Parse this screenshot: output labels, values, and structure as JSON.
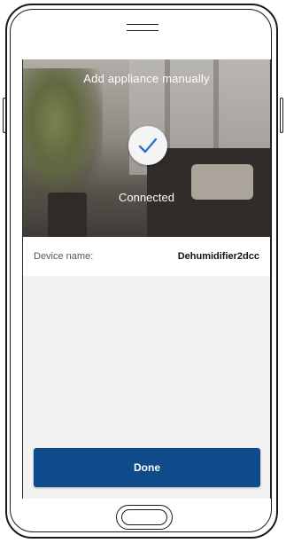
{
  "screen": {
    "title": "Add appliance manually",
    "status": "Connected",
    "status_icon": "checkmark-icon",
    "accent_color": "#0f4a8a"
  },
  "device": {
    "label": "Device name:",
    "value": "Dehumidifier2dcc"
  },
  "actions": {
    "done_label": "Done"
  }
}
